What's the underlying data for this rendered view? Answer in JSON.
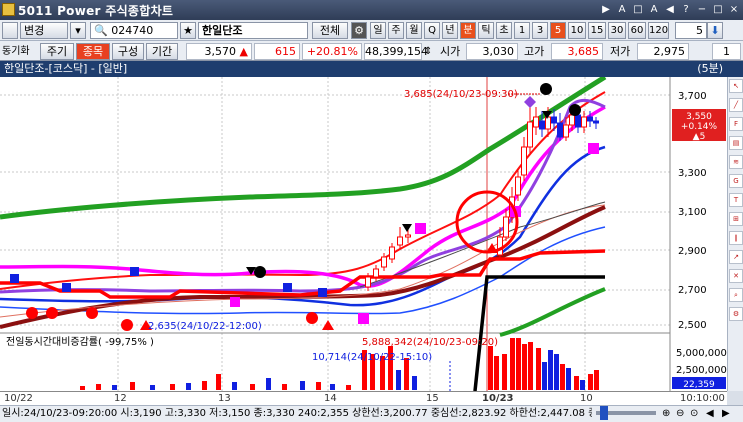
{
  "window": {
    "title": "5011  Power 주식종합차트",
    "buttons": [
      "▶",
      "A",
      "□",
      "A",
      "◀",
      "?",
      "−",
      "□",
      "×"
    ]
  },
  "toolbar": {
    "change_label": "변경",
    "code": "024740",
    "stock_name": "한일단조",
    "all_label": "전체",
    "period_buttons": [
      "일",
      "주",
      "월",
      "Q",
      "년",
      "분",
      "틱",
      "초",
      "1",
      "3",
      "5",
      "10",
      "15",
      "30",
      "60",
      "120"
    ],
    "active_period": "5",
    "count_value": "5"
  },
  "quote_row": {
    "sync_label": "동기화",
    "period_label": "주기",
    "item_label": "종목",
    "compose_label": "구성",
    "range_label": "기간",
    "price": "3,570",
    "change": "615",
    "change_pct": "+20.81%",
    "volume": "48,399,154",
    "open_label": "시가",
    "open": "3,030",
    "high_label": "고가",
    "high": "3,685",
    "low_label": "저가",
    "low": "2,975",
    "page": "1"
  },
  "chart_head": {
    "title": "한일단조-[코스닥] - [일반]",
    "interval": "(5분)"
  },
  "chart": {
    "high_label": "3,685(24/10/23-09:30)",
    "low_label": "2,635(24/10/22-12:00)",
    "price_box": {
      "price": "3,550",
      "pct": "+0.14%",
      "chg": "▲5"
    },
    "price_ticks": [
      "3,700",
      "3,500",
      "3,300",
      "3,100",
      "2,900",
      "2,700",
      "2,500"
    ],
    "volume_title": "전일동시간대비증감률( -99,75% )",
    "vol_high_label": "5,888,342(24/10/23-09:20)",
    "vol_low_label": "10,714(24/10/22-15:10)",
    "vol_ticks": [
      "5,000,000",
      "2,500,000"
    ],
    "vol_current": "22,359",
    "x_ticks": [
      "10/22",
      "12",
      "13",
      "14",
      "15",
      "10/23",
      "10"
    ],
    "bottom_time": "10:10:00"
  },
  "status_line": "일시:24/10/23-09:20:00 시:3,190 고:3,330 저:3,150 종:3,330 240:2,355 상한선:3,200.77 중심선:2,823.92 하한선:2,447.08 중심",
  "colors": {
    "up": "#ff0000",
    "down": "#0000ff",
    "green": "#22a022",
    "magenta": "#ff00ff",
    "purple": "#8a2be2",
    "maroon": "#8b1010"
  }
}
